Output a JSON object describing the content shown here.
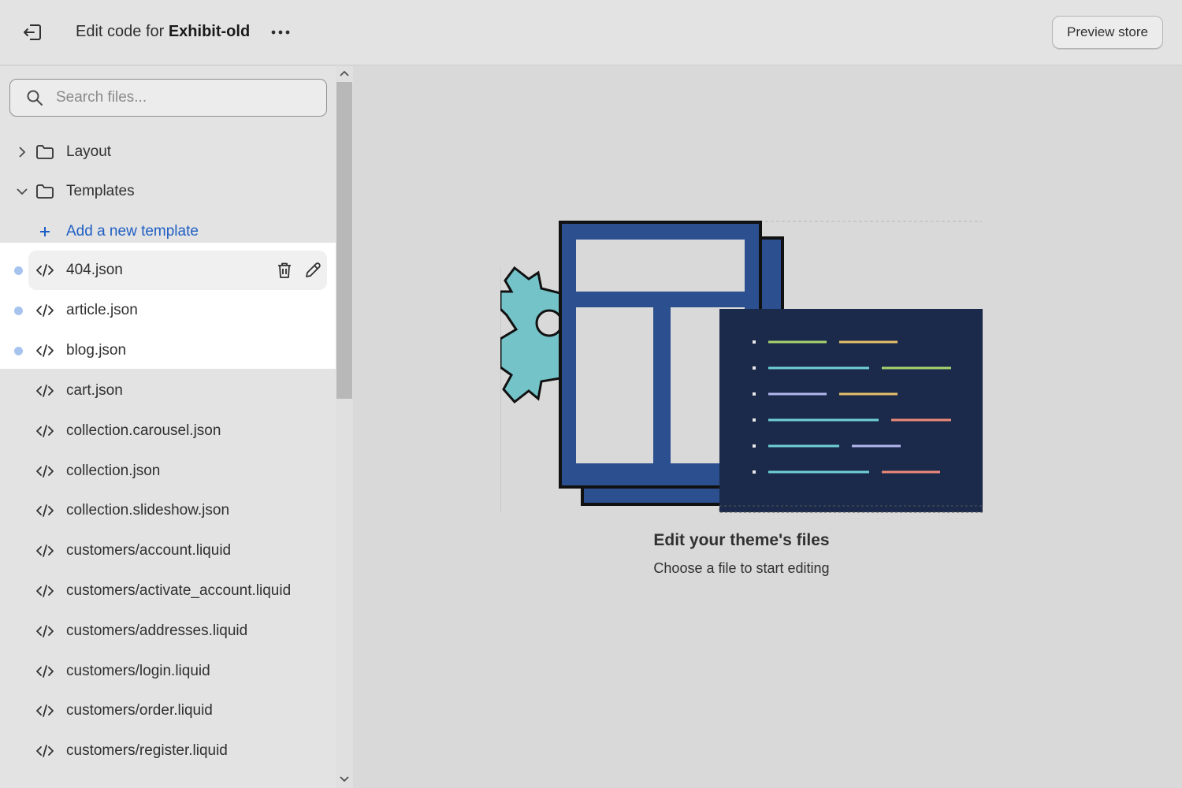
{
  "header": {
    "title_prefix": "Edit code for ",
    "theme_name": "Exhibit-old",
    "more_label": "•••",
    "preview_label": "Preview store"
  },
  "search": {
    "placeholder": "Search files..."
  },
  "tree": {
    "folders": [
      {
        "label": "Layout",
        "expanded": false
      },
      {
        "label": "Templates",
        "expanded": true
      }
    ],
    "add_template_label": "Add a new template",
    "files": [
      {
        "label": "404.json",
        "modified": true
      },
      {
        "label": "article.json",
        "modified": true
      },
      {
        "label": "blog.json",
        "modified": true
      },
      {
        "label": "cart.json",
        "modified": false
      },
      {
        "label": "collection.carousel.json",
        "modified": false
      },
      {
        "label": "collection.json",
        "modified": false
      },
      {
        "label": "collection.slideshow.json",
        "modified": false
      },
      {
        "label": "customers/account.liquid",
        "modified": false
      },
      {
        "label": "customers/activate_account.liquid",
        "modified": false
      },
      {
        "label": "customers/addresses.liquid",
        "modified": false
      },
      {
        "label": "customers/login.liquid",
        "modified": false
      },
      {
        "label": "customers/order.liquid",
        "modified": false
      },
      {
        "label": "customers/register.liquid",
        "modified": false
      }
    ]
  },
  "empty_state": {
    "title": "Edit your theme's files",
    "subtitle": "Choose a file to start editing"
  },
  "colors": {
    "accent_link": "#1f5fc4",
    "modified_dot": "#a7c4ef",
    "illustration_navy": "#1b2a4a",
    "illustration_blue": "#2b4f8f",
    "illustration_teal": "#74c3c9"
  }
}
